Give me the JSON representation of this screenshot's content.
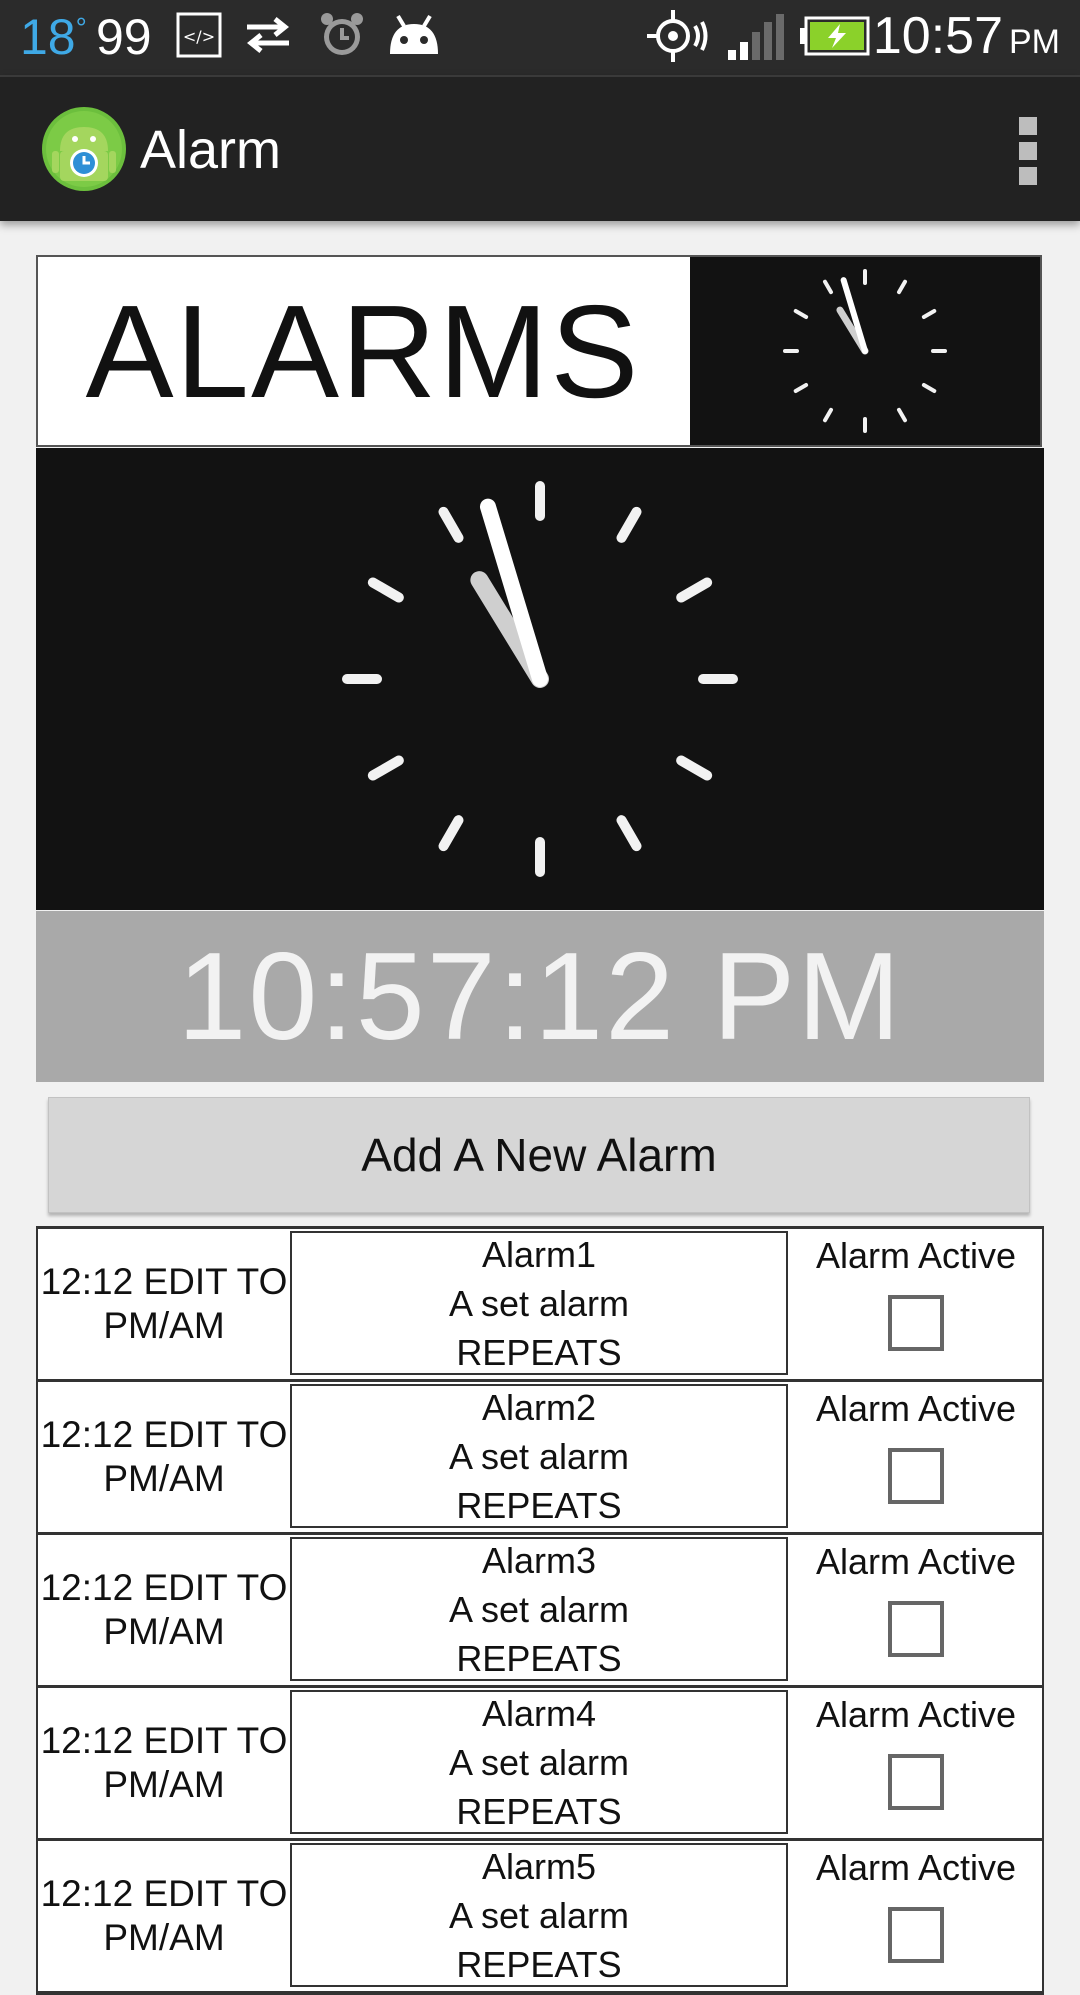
{
  "status_bar": {
    "temperature": "18",
    "temperature_unit": "°",
    "notification_count": "99",
    "time": "10:57",
    "ampm": "PM",
    "icons": [
      "code-icon",
      "sync-arrows-icon",
      "alarm-clock-icon",
      "android-icon",
      "gps-icon",
      "signal-icon",
      "battery-charging-icon"
    ]
  },
  "action_bar": {
    "title": "Alarm",
    "menu": "overflow-menu-icon"
  },
  "header": {
    "title": "ALARMS"
  },
  "clock": {
    "hour": 10,
    "minute": 57,
    "second": 12
  },
  "digital_time": "10:57:12 PM",
  "add_button": "Add A New Alarm",
  "alarms": [
    {
      "time": "12:12 EDIT TO PM/AM",
      "name": "Alarm1",
      "desc": "A set alarm",
      "repeat": "REPEATS",
      "active_label": "Alarm Active",
      "active": false
    },
    {
      "time": "12:12 EDIT TO PM/AM",
      "name": "Alarm2",
      "desc": "A set alarm",
      "repeat": "REPEATS",
      "active_label": "Alarm Active",
      "active": false
    },
    {
      "time": "12:12 EDIT TO PM/AM",
      "name": "Alarm3",
      "desc": "A set alarm",
      "repeat": "REPEATS",
      "active_label": "Alarm Active",
      "active": false
    },
    {
      "time": "12:12 EDIT TO PM/AM",
      "name": "Alarm4",
      "desc": "A set alarm",
      "repeat": "REPEATS",
      "active_label": "Alarm Active",
      "active": false
    },
    {
      "time": "12:12 EDIT TO PM/AM",
      "name": "Alarm5",
      "desc": "A set alarm",
      "repeat": "REPEATS",
      "active_label": "Alarm Active",
      "active": false
    }
  ],
  "colors": {
    "status_bar": "#2b2b2b",
    "action_bar": "#222222",
    "clock_face": "#121212",
    "time_strip": "#a9a9a9",
    "temperature": "#3fa9e6",
    "battery": "#8bd12a"
  }
}
